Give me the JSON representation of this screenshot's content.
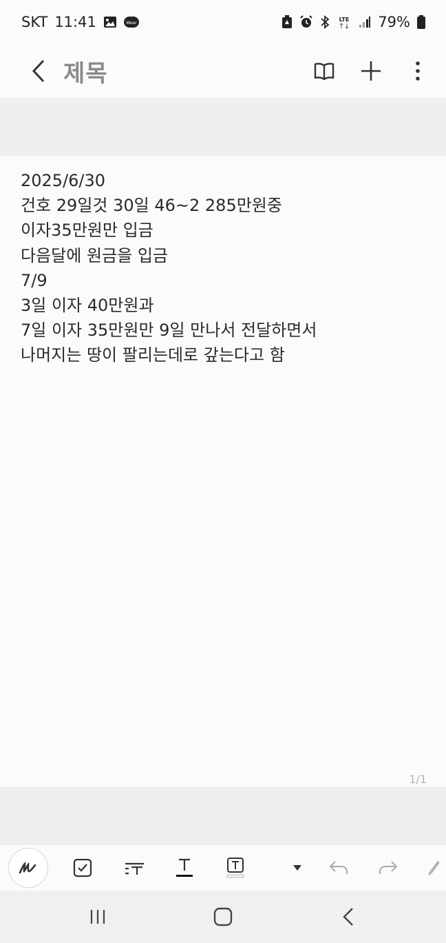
{
  "status_bar": {
    "carrier": "SKT",
    "time": "11:41",
    "battery": "79%",
    "network": "LTE",
    "left_icons": [
      "gallery-icon",
      "wear-icon"
    ],
    "right_icons": [
      "battery-saver-icon",
      "alarm-icon",
      "bluetooth-icon",
      "lte-icon",
      "signal-icon",
      "battery-icon"
    ],
    "wear_label": "Wear"
  },
  "appbar": {
    "title": "제목"
  },
  "note": {
    "lines": [
      "2025/6/30",
      "건호 29일것 30일 46~2 285만원중",
      "이자35만원만 입금",
      "다음달에 원금을 입금",
      "7/9",
      "3일 이자 40만원과",
      "7일 이자 35만원만 9일 만나서 전달하면서",
      "나머지는 땅이 팔리는데로 갚는다고 함"
    ],
    "page_indicator": "1/1"
  },
  "toolbar": {
    "tools": [
      "pen-icon",
      "checkbox-icon",
      "text-style-icon",
      "text-color-icon",
      "text-background-icon",
      "dropdown-icon",
      "undo-icon",
      "redo-icon",
      "eraser-icon"
    ]
  },
  "navbar": {
    "buttons": [
      "recent-apps-icon",
      "home-icon",
      "back-icon"
    ]
  }
}
